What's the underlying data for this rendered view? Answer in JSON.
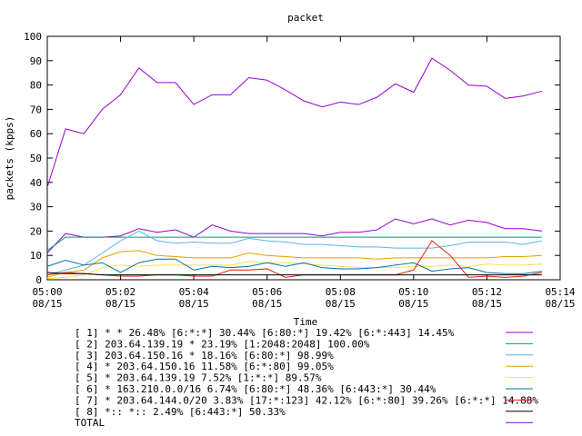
{
  "chart_data": {
    "type": "line",
    "title": "packet",
    "xlabel": "Time",
    "ylabel": "packets (kpps)",
    "ylim": [
      0,
      100
    ],
    "yticks": [
      0,
      10,
      20,
      30,
      40,
      50,
      60,
      70,
      80,
      90,
      100
    ],
    "xlim": [
      "05:00",
      "05:14"
    ],
    "xticks": [
      {
        "time": "05:00",
        "date": "08/15"
      },
      {
        "time": "05:02",
        "date": "08/15"
      },
      {
        "time": "05:04",
        "date": "08/15"
      },
      {
        "time": "05:06",
        "date": "08/15"
      },
      {
        "time": "05:08",
        "date": "08/15"
      },
      {
        "time": "05:10",
        "date": "08/15"
      },
      {
        "time": "05:12",
        "date": "08/15"
      },
      {
        "time": "05:14",
        "date": "08/15"
      }
    ],
    "x": [
      "05:00:00",
      "05:00:30",
      "05:01:00",
      "05:01:30",
      "05:02:00",
      "05:02:30",
      "05:03:00",
      "05:03:30",
      "05:04:00",
      "05:04:30",
      "05:05:00",
      "05:05:30",
      "05:06:00",
      "05:06:30",
      "05:07:00",
      "05:07:30",
      "05:08:00",
      "05:08:30",
      "05:09:00",
      "05:09:30",
      "05:10:00",
      "05:10:30",
      "05:11:00",
      "05:11:30",
      "05:12:00",
      "05:12:30",
      "05:13:00",
      "05:13:30"
    ],
    "legend_position": "bottom",
    "series": [
      {
        "name": "[ 1] * * 26.48%  [6:*:*] 30.44% [6:80:*] 19.42% [6:*:443] 14.45%",
        "color": "#9400d3",
        "values": [
          11,
          19,
          17.5,
          17.5,
          18,
          21,
          19.5,
          20.5,
          17.5,
          22.5,
          20,
          19,
          19,
          19,
          19,
          18,
          19.5,
          19.5,
          20.5,
          25,
          23,
          25,
          22.5,
          24.5,
          23.5,
          21,
          21,
          20
        ]
      },
      {
        "name": "[ 2] 203.64.139.19 * 23.19%  [1:2048:2048] 100.00%",
        "color": "#009e73",
        "values": [
          12,
          17.5,
          17.5,
          17.5,
          17.5,
          17.5,
          17.5,
          17.5,
          17.5,
          17.5,
          17.5,
          17.5,
          17.5,
          17.5,
          17.5,
          17.5,
          17.5,
          17.5,
          17.5,
          17.5,
          17.5,
          17.5,
          17.5,
          17.5,
          17.5,
          17.5,
          17.5,
          17.5
        ]
      },
      {
        "name": "[ 3] 203.64.150.16 * 18.16%  [6:80:*] 98.99%",
        "color": "#56b4e9",
        "values": [
          2,
          4,
          6,
          11,
          16,
          20,
          16,
          15,
          15.5,
          15,
          15,
          17,
          16,
          15.5,
          14.5,
          14.5,
          14,
          13.5,
          13.5,
          13,
          13,
          13,
          14,
          15.5,
          15.5,
          15.5,
          14.5,
          16
        ]
      },
      {
        "name": "[ 4] * 203.64.150.16 11.58%  [6:*:80] 99.05%",
        "color": "#e69f00",
        "values": [
          1,
          3,
          4,
          9,
          11.5,
          12,
          10,
          9.5,
          9,
          9,
          9,
          11,
          10,
          9.5,
          9,
          9,
          9,
          9,
          8.5,
          9,
          9,
          9,
          9,
          9,
          9,
          9.5,
          9.5,
          10
        ]
      },
      {
        "name": "[ 5] * 203.64.139.19 7.52%  [1:*:*] 89.57%",
        "color": "#f0e442",
        "values": [
          0.5,
          1,
          2,
          5,
          6,
          5.5,
          6,
          6,
          6,
          6,
          6,
          7.5,
          7,
          7,
          6.5,
          6,
          5.5,
          5,
          5,
          5,
          5.5,
          5.5,
          6,
          5.5,
          6.5,
          6,
          6,
          6.5
        ]
      },
      {
        "name": "[ 6] * 163.210.0.0/16 6.74%  [6:80:*] 48.36% [6:443:*] 30.44%",
        "color": "#0072b2",
        "values": [
          5.5,
          8,
          6,
          7,
          3,
          7,
          8.5,
          8.5,
          4,
          5.5,
          5,
          5.5,
          7,
          5.5,
          7,
          5,
          4.5,
          4.5,
          5,
          6,
          7,
          3.5,
          4.5,
          5,
          3,
          2.5,
          2.5,
          3.5
        ]
      },
      {
        "name": "[ 7] * 203.64.144.0/20 3.83%  [17:*:123] 42.12% [6:*:80] 39.26% [6:*:*] 14.88%",
        "color": "#e51e10",
        "values": [
          2,
          3,
          2.5,
          2,
          1.5,
          1.5,
          2,
          2,
          1.5,
          1.5,
          4,
          4,
          4.5,
          1,
          2,
          2,
          2,
          2,
          2,
          2,
          4,
          16,
          10,
          1,
          1.5,
          1,
          1.5,
          3
        ]
      },
      {
        "name": "[ 8] *:: *:: 2.49%  [6:443:*] 50.33%",
        "color": "#000000",
        "values": [
          3,
          2.5,
          2.5,
          2,
          2,
          2,
          2,
          2,
          2,
          2,
          2,
          2,
          2,
          2,
          2,
          2,
          2,
          2,
          2,
          2,
          2,
          2,
          2,
          2,
          2,
          2,
          2,
          2
        ]
      },
      {
        "name": "TOTAL",
        "color": "#9400d3",
        "values": [
          38,
          62,
          60,
          70,
          76,
          87,
          81,
          81,
          72,
          76,
          76,
          83,
          82,
          78,
          73.5,
          71,
          73,
          72,
          75,
          80.5,
          77,
          91,
          86,
          80,
          79.5,
          74.5,
          75.5,
          77.5
        ]
      }
    ]
  }
}
